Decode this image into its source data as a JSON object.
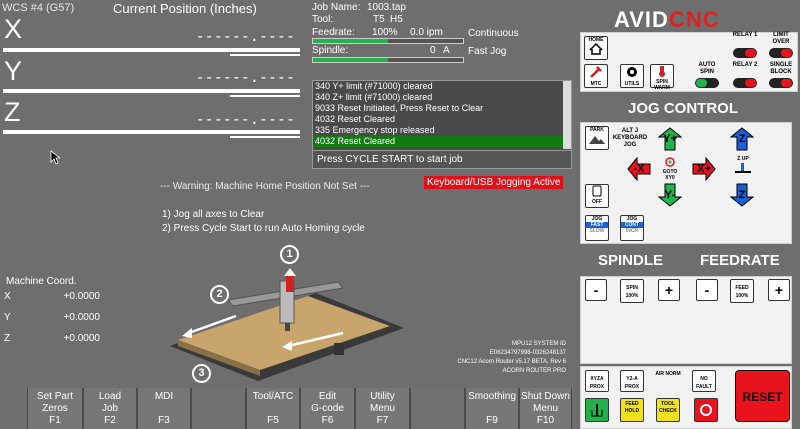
{
  "dro": {
    "wcs": "WCS #4 (G57)",
    "title": "Current Position (Inches)",
    "axes": [
      {
        "letter": "X",
        "value": "------.----"
      },
      {
        "letter": "Y",
        "value": "------.----"
      },
      {
        "letter": "Z",
        "value": "------.----"
      }
    ]
  },
  "job": {
    "name_label": "Job Name:",
    "name": "1003.tap",
    "tool_label": "Tool:",
    "tool": "T5",
    "height": "H5",
    "feedrate_label": "Feedrate:",
    "feedrate_pct": "100%",
    "feedrate_val": "0.0 ipm",
    "feed_mode": "Continuous",
    "feed_bar": 0.5,
    "spindle_label": "Spindle:",
    "spindle_val": "0",
    "spindle_unit": "A",
    "spindle_mode": "Fast Jog",
    "spindle_bar": 0.5
  },
  "log": {
    "lines": [
      "340 Y+ limit (#71000) cleared",
      "340 Z+ limit (#71000) cleared",
      "9033 Reset Initiated, Press Reset to Clear",
      "4032 Reset Cleared",
      "335 Emergency stop released",
      "4032 Reset Cleared"
    ],
    "prompt": "Press CYCLE START to start job"
  },
  "warning": "--- Warning: Machine Home Position Not Set ---",
  "keyboard_badge": "Keyboard/USB Jogging Active",
  "instructions": [
    "1) Jog all axes to Clear",
    "2) Press Cycle Start to run Auto Homing cycle"
  ],
  "machine_coord": {
    "title": "Machine Coord.",
    "axes": [
      {
        "letter": "X",
        "value": "+0.0000"
      },
      {
        "letter": "Y",
        "value": "+0.0000"
      },
      {
        "letter": "Z",
        "value": "+0.0000"
      }
    ]
  },
  "diagram": {
    "steps": [
      "1",
      "2",
      "3"
    ]
  },
  "sysinfo": [
    "MPU12 SYSTEM ID",
    "E06234797998-0326248137",
    "CNC12 Acorn Router v5.17 BETA, Rev 6",
    "ACORN ROUTER PRO"
  ],
  "fkeys": [
    {
      "label1": "Set Part",
      "label2": "Zeros",
      "key": "F1"
    },
    {
      "label1": "Load",
      "label2": "Job",
      "key": "F2"
    },
    {
      "label1": "MDI",
      "label2": "",
      "key": "F3"
    },
    {
      "label1": "",
      "label2": "",
      "key": ""
    },
    {
      "label1": "Tool/ATC",
      "label2": "",
      "key": "F5"
    },
    {
      "label1": "Edit",
      "label2": "G-code",
      "key": "F6"
    },
    {
      "label1": "Utility",
      "label2": "Menu",
      "key": "F7"
    },
    {
      "label1": "",
      "label2": "",
      "key": ""
    },
    {
      "label1": "Smoothing",
      "label2": "",
      "key": "F9"
    },
    {
      "label1": "Shut Down",
      "label2": "Menu",
      "key": "F10"
    }
  ],
  "brand": {
    "part1": "AVID",
    "part2": "CNC"
  },
  "panel": {
    "home": "HOME",
    "mtc": "MTC",
    "utils": "UTILS",
    "spin_warm": "SPIN WARM",
    "auto_spin": "AUTO SPIN",
    "relay1": "RELAY 1",
    "relay2": "RELAY 2",
    "limit_over": "LIMIT OVER",
    "single_block": "SINGLE BLOCK",
    "jog_title": "JOG CONTROL",
    "park": "PARK",
    "alt_j": "ALT J KEYBOARD JOG",
    "goto": "GOTO XY0",
    "z_up": "Z UP",
    "off": "OFF",
    "jog_fast": "JOG",
    "fast": "FAST",
    "slow": "SLOW",
    "jog_cont": "JOG",
    "cont": "CONT",
    "incr": "INCR",
    "y_plus": "Y+",
    "y_minus": "Y-",
    "x_plus": "X+",
    "x_minus": "-X",
    "z_plus": "Z",
    "z_minus": "Z",
    "spindle_title": "SPINDLE",
    "feedrate_title": "FEEDRATE",
    "spin100": "SPIN 100%",
    "feed100": "FEED 100%",
    "minus": "-",
    "plus": "+",
    "xyza_prox": "XYZA PROX",
    "y2a_prox": "Y2-A PROX",
    "air_norm": "AIR NORM",
    "no_fault": "NO FAULT",
    "feed_hold": "FEED HOLD",
    "tool_check": "TOOL CHECK",
    "reset": "RESET",
    "colors": {
      "red": "#e8131d",
      "green": "#22b14c",
      "blue": "#1a5fd6",
      "yellow": "#f2e21b"
    }
  }
}
